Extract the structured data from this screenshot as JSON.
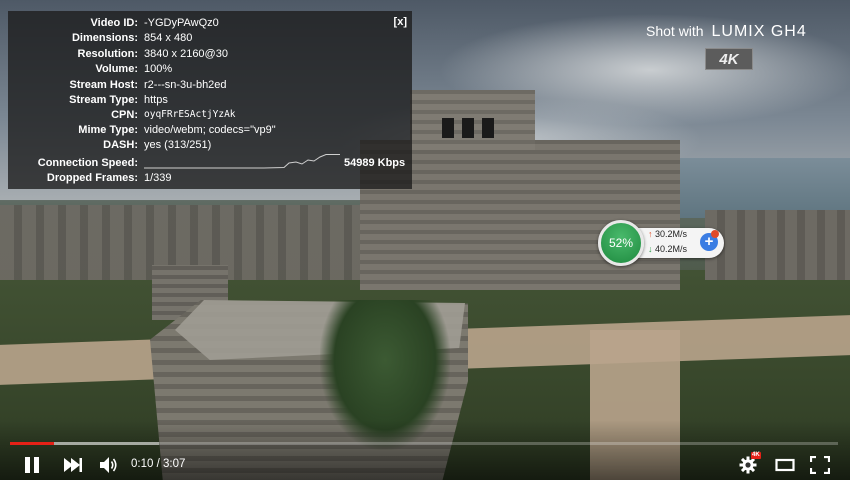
{
  "stats": {
    "close_label": "[x]",
    "rows": [
      {
        "label": "Video ID:",
        "value": "-YGDyPAwQz0"
      },
      {
        "label": "Dimensions:",
        "value": "854 x 480"
      },
      {
        "label": "Resolution:",
        "value": "3840 x 2160@30"
      },
      {
        "label": "Volume:",
        "value": "100%"
      },
      {
        "label": "Stream Host:",
        "value": "r2---sn-3u-bh2ed"
      },
      {
        "label": "Stream Type:",
        "value": "https"
      },
      {
        "label": "CPN:",
        "value": "oyqFRrESActjYzAk"
      },
      {
        "label": "Mime Type:",
        "value": "video/webm; codecs=\"vp9\""
      },
      {
        "label": "DASH:",
        "value": "yes (313/251)"
      },
      {
        "label": "Connection Speed:",
        "value": "54989 Kbps"
      },
      {
        "label": "Dropped Frames:",
        "value": "1/339"
      }
    ]
  },
  "watermark": {
    "shot_with": "Shot with",
    "brand": "LUMIX GH4",
    "badge": "4K"
  },
  "speed_widget": {
    "percent": "52%",
    "upload": "30.2M/s",
    "download": "40.2M/s",
    "up_arrow": "↑",
    "down_arrow": "↓",
    "plus": "+"
  },
  "player": {
    "current_time": "0:10",
    "separator": " / ",
    "duration": "3:07",
    "played_fraction": 0.053,
    "buffered_fraction": 0.18,
    "quality_badge": "4K",
    "colors": {
      "progress": "#e52117"
    }
  }
}
